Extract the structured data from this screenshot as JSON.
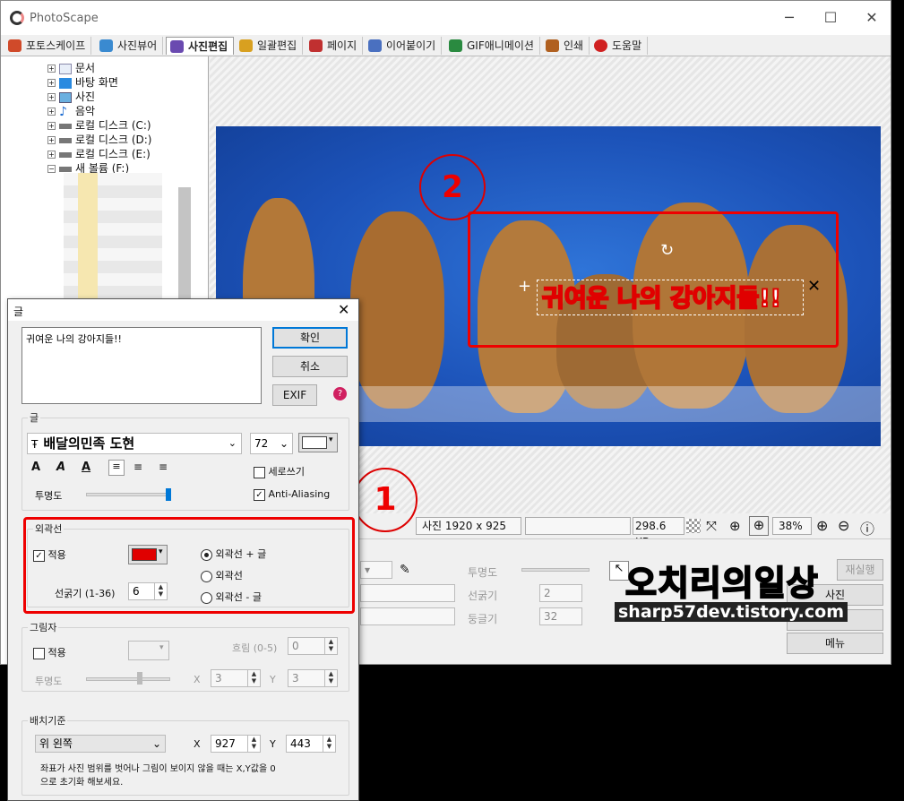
{
  "app": {
    "title": "PhotoScape"
  },
  "window_controls": {
    "minimize": "─",
    "maximize": "☐",
    "close": "✕"
  },
  "tabs": [
    {
      "label": "포토스케이프",
      "color": "#d04a2a"
    },
    {
      "label": "사진뷰어",
      "color": "#3a8ad0"
    },
    {
      "label": "사진편집",
      "color": "#6a4ab0"
    },
    {
      "label": "일괄편집",
      "color": "#d8a020"
    },
    {
      "label": "페이지",
      "color": "#c03030"
    },
    {
      "label": "이어붙이기",
      "color": "#4a70c0"
    },
    {
      "label": "GIF애니메이션",
      "color": "#2a8a40"
    },
    {
      "label": "인쇄",
      "color": "#b06020"
    },
    {
      "label": "도움말",
      "color": "#d02020"
    }
  ],
  "tree": [
    {
      "label": "문서",
      "icon": "document-icon"
    },
    {
      "label": "바탕 화면",
      "icon": "desktop-icon"
    },
    {
      "label": "사진",
      "icon": "pictures-icon"
    },
    {
      "label": "음악",
      "icon": "music-icon"
    },
    {
      "label": "로컬 디스크 (C:)",
      "icon": "drive-icon"
    },
    {
      "label": "로컬 디스크 (D:)",
      "icon": "drive-icon"
    },
    {
      "label": "로컬 디스크 (E:)",
      "icon": "drive-icon"
    },
    {
      "label": "새 볼륨 (F:)",
      "icon": "drive-icon"
    }
  ],
  "canvas": {
    "overlay_text": "귀여운 나의 강아지들!!",
    "annotation_2": "2",
    "annotation_1": "1"
  },
  "status": {
    "dimensions": "사진 1920 x 925",
    "filesize": "298.6 KB",
    "zoom": "38%"
  },
  "bottom_panel": {
    "opacity_label": "투명도",
    "thickness_label": "선굵기",
    "thickness_value": "2",
    "round_label": "둥글기",
    "round_value": "32",
    "rerun_label": "재실행",
    "photo_label": "사진",
    "menu_label": "메뉴"
  },
  "watermark": {
    "line1": "오치리의일상",
    "line2": "sharp57dev.tistory.com"
  },
  "dialog": {
    "title": "글",
    "text_value": "귀여운 나의 강아지들!!",
    "ok": "확인",
    "cancel": "취소",
    "exif": "EXIF",
    "font_group": "글",
    "font_name": "배달의민족 도현",
    "font_size": "72",
    "font_color": "#ffffff",
    "vertical_label": "세로쓰기",
    "antialias_label": "Anti-Aliasing",
    "opacity_label": "투명도",
    "outline_group": "외곽선",
    "outline_apply": "적용",
    "outline_color": "#e00000",
    "outline_opt1": "외곽선 + 글",
    "outline_opt2": "외곽선",
    "outline_opt3": "외곽선 - 글",
    "outline_thickness_label": "선굵기 (1-36)",
    "outline_thickness": "6",
    "shadow_group": "그림자",
    "shadow_apply": "적용",
    "shadow_blur_label": "흐림 (0-5)",
    "shadow_blur": "0",
    "shadow_opacity_label": "투명도",
    "shadow_x_label": "X",
    "shadow_x": "3",
    "shadow_y_label": "Y",
    "shadow_y": "3",
    "position_group": "배치기준",
    "position_value": "위 왼쪽",
    "pos_x_label": "X",
    "pos_x": "927",
    "pos_y_label": "Y",
    "pos_y": "443",
    "note": "좌표가 사진 범위를 벗어나 그림이 보이지 않을 때는 X,Y값을 0으로 초기화 해보세요."
  }
}
